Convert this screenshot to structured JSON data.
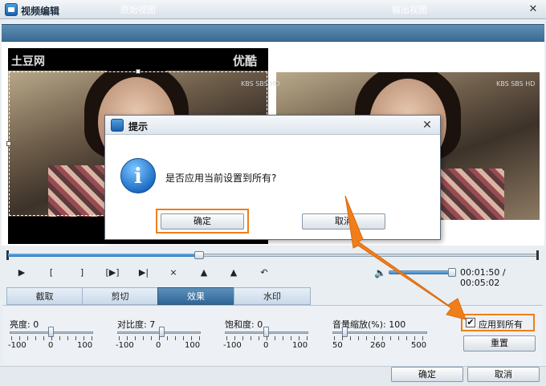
{
  "window": {
    "title": "视频编辑",
    "close_glyph": "✕"
  },
  "headers": {
    "original": "原始视图",
    "output": "输出视图"
  },
  "watermarks": {
    "left": "土豆网",
    "right": "优酷",
    "sbs": "KBS SBS HD"
  },
  "player": {
    "time_current": "00:01:50",
    "time_total": "00:05:02",
    "time_separator": " / ",
    "timeline_progress": 0.36,
    "volume_level": 0.92,
    "controls": [
      "▶",
      "[",
      "]",
      "[▶]",
      "▶|",
      "⨯",
      "▲",
      "▲",
      "↶"
    ]
  },
  "tabs": [
    {
      "label": "截取",
      "active": false
    },
    {
      "label": "剪切",
      "active": false
    },
    {
      "label": "效果",
      "active": true
    },
    {
      "label": "水印",
      "active": false
    }
  ],
  "settings": {
    "brightness": {
      "label": "亮度: 0",
      "min": "-100",
      "mid": "0",
      "max": "100",
      "value": 0
    },
    "contrast": {
      "label": "对比度: 7",
      "min": "-100",
      "mid": "0",
      "max": "100",
      "value": 7
    },
    "saturation": {
      "label": "饱和度: 0",
      "min": "-100",
      "mid": "0",
      "max": "100",
      "value": 0
    },
    "volume_zoom": {
      "label": "音量缩放(%): 100",
      "min": "50",
      "mid": "260",
      "max": "500",
      "value": 100
    },
    "apply_all": {
      "label": "应用到所有",
      "checked": true,
      "check_glyph": "✔"
    },
    "reset_label": "重置"
  },
  "footer": {
    "ok_label": "确定",
    "cancel_label": "取消"
  },
  "dialog": {
    "title": "提示",
    "message": "是否应用当前设置到所有?",
    "ok_label": "确定",
    "cancel_label": "取消",
    "info_glyph": "i",
    "close_glyph": "✕"
  },
  "colors": {
    "highlight": "#f07e1a",
    "header": "#3b6b92",
    "accent": "#2f77be"
  }
}
